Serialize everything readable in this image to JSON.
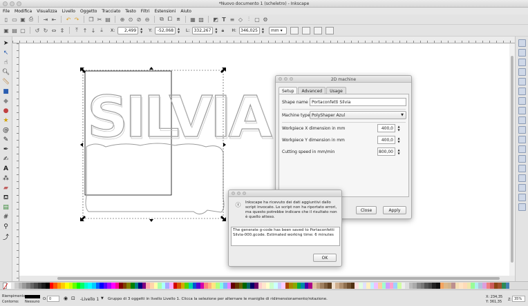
{
  "window": {
    "title": "*Nuovo documento 1 (scheletro) - Inkscape"
  },
  "menu": [
    "File",
    "Modifica",
    "Visualizza",
    "Livello",
    "Oggetto",
    "Tracciato",
    "Testo",
    "Filtri",
    "Estensioni",
    "Aiuto"
  ],
  "controls": {
    "x_label": "X:",
    "x_value": "2,499",
    "y_label": "Y:",
    "y_value": "-52,068",
    "w_label": "L:",
    "w_value": "332,267",
    "h_label": "H:",
    "h_value": "346,025",
    "unit": "mm"
  },
  "canvas": {
    "text_line1": "SILVIA"
  },
  "dialog_2d": {
    "title": "2D machine",
    "tabs": [
      "Setup",
      "Advanced",
      "Usage"
    ],
    "shape_name_label": "Shape name",
    "shape_name_value": "Portaconfetti Silvia",
    "machine_type_label": "Machine type",
    "machine_type_value": "PolyShaper Azul",
    "wx_label": "Workpiece X dimension in mm",
    "wx_value": "400,0",
    "wy_label": "Workpiece Y dimension in mm",
    "wy_value": "400,0",
    "speed_label": "Cutting speed in mm/min",
    "speed_value": "800,00",
    "close_label": "Close",
    "apply_label": "Apply"
  },
  "dialog_msg": {
    "message": "Inkscape ha ricevuto dei dati aggiuntivi dallo script invocato. Lo script non ha riportato errori, ma questo potrebbe indicare che il risultato non è quello atteso.",
    "output": "The generate g-code has been saved to Portaconfetti Silvia-000.gcode. Estimated working time: 6 minutes",
    "ok_label": "OK"
  },
  "statusbar": {
    "fill_label": "Riempimento:",
    "stroke_label": "Contorno:",
    "stroke_value": "Nessuno",
    "opacity_label": "O:",
    "opacity_value": "0",
    "layer": "-Livello 1",
    "message": "Gruppo di 3 oggetti in livello Livello 1. Clicca la selezione per alternare le maniglie di ridimensionamento/rotazione.",
    "x_coord": "X: 234,35",
    "y_coord": "Y: 361,35",
    "zoom_label": "Z:",
    "zoom_value": "35%"
  },
  "palette": [
    "#ffffff",
    "#e6e6e6",
    "#cccccc",
    "#b3b3b3",
    "#999999",
    "#808080",
    "#666666",
    "#4d4d4d",
    "#333333",
    "#1a1a1a",
    "#000000",
    "#ff0000",
    "#ff5500",
    "#ff9900",
    "#ffcc00",
    "#ffff00",
    "#ccff00",
    "#66ff00",
    "#00ff00",
    "#00ff66",
    "#00ffcc",
    "#00ffff",
    "#00ccff",
    "#0066ff",
    "#0000ff",
    "#5500ff",
    "#aa00ff",
    "#ff00ff",
    "#ff0099",
    "#800000",
    "#804000",
    "#808000",
    "#008000",
    "#008080",
    "#000080",
    "#800080",
    "#ffaaaa",
    "#ffd5aa",
    "#ffffaa",
    "#aaffaa",
    "#aaffff",
    "#aaaaff",
    "#ffaaff",
    "#d40000",
    "#d45500",
    "#d4aa00",
    "#55d400",
    "#00d4aa",
    "#0055d4",
    "#5500d4",
    "#d400aa",
    "#ff8080",
    "#ffb380",
    "#ffe680",
    "#b3ff80",
    "#80ffe6",
    "#80b3ff",
    "#e680ff",
    "#660000",
    "#663300",
    "#666600",
    "#006600",
    "#006666",
    "#000066",
    "#660066",
    "#ffcccc",
    "#ffe6cc",
    "#ffffcc",
    "#ccffcc",
    "#ccffff",
    "#ccccff",
    "#ffccff",
    "#aa4400",
    "#aa8800",
    "#88aa00",
    "#00aa44",
    "#0088aa",
    "#4400aa",
    "#aa0088",
    "#e0c0a0",
    "#c0a080",
    "#a08060",
    "#806040",
    "#604020",
    "#f0e0d0",
    "#d0b090",
    "#b09070",
    "#907050",
    "#705030",
    "#503010",
    "#ffe0e0",
    "#e0ffe0",
    "#e0e0ff",
    "#fff0c0",
    "#c0f0ff",
    "#f0c0ff",
    "#ffd0a0",
    "#a0ffd0",
    "#d0a0ff",
    "#ffa0d0",
    "#a0d0ff",
    "#d0ffa0",
    "#eeeeee",
    "#dddddd",
    "#bbbbbb",
    "#aaaaaa",
    "#888888",
    "#777777",
    "#555555",
    "#444444",
    "#222222",
    "#111111",
    "#f4a460",
    "#deb887",
    "#d2b48c",
    "#bc8f8f",
    "#f5deb3",
    "#ffe4c4",
    "#ffdab9",
    "#eee8aa",
    "#98fb98",
    "#afeeee",
    "#b0c4de",
    "#dda0dd",
    "#f08080",
    "#cd5c5c",
    "#8b4513",
    "#a0522d",
    "#2e8b57",
    "#4682b4"
  ]
}
